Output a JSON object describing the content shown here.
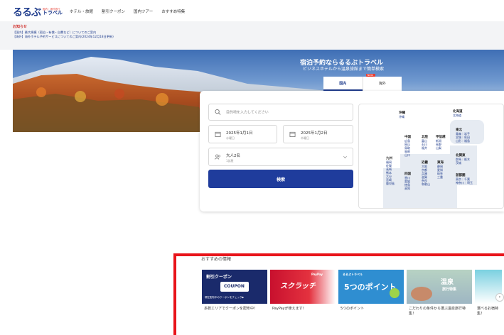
{
  "header": {
    "logo_mark": "るるぶ",
    "logo_tag": "国内・海外旅行",
    "logo_name": "トラベル",
    "nav": [
      "ホテル・旅館",
      "割引クーポン",
      "国内ツアー",
      "おすすめ特集"
    ]
  },
  "notice": {
    "title": "お知らせ",
    "links": [
      "【国内】最大規模（宿泊・有償・自費など）についてのご案内",
      "【海外】海外ホテル予約サービスについてのご案内(2024年12月18日更新)"
    ]
  },
  "hero": {
    "title": "宿泊予約ならるるぶトラベル",
    "subtitle": "ビジネスホテルから温泉旅館まで簡単検索",
    "tabs": [
      {
        "label": "国内",
        "active": true
      },
      {
        "label": "海外",
        "badge": "New!"
      }
    ]
  },
  "search": {
    "destination_placeholder": "目的地を入力してください",
    "checkin_date": "2025年1月1日",
    "checkin_day": "水曜日",
    "checkout_date": "2025年1月2日",
    "checkout_day": "木曜日",
    "guests": "大人2名",
    "rooms": "1部屋",
    "search_label": "検索"
  },
  "map": {
    "regions": [
      {
        "name": "沖縄",
        "prefs": [
          "沖縄"
        ]
      },
      {
        "name": "北海道",
        "prefs": [
          "北海道"
        ]
      },
      {
        "name": "東北",
        "prefs": [
          "青森｜岩手",
          "宮城｜秋田",
          "山形｜福島"
        ]
      },
      {
        "name": "中国",
        "prefs": [
          "広島",
          "岡山",
          "鳥取",
          "島根",
          "山口"
        ]
      },
      {
        "name": "北陸",
        "prefs": [
          "富山",
          "石川",
          "福井"
        ]
      },
      {
        "name": "甲信越",
        "prefs": [
          "新潟",
          "長野",
          "山梨"
        ]
      },
      {
        "name": "北関東",
        "prefs": [
          "群馬｜栃木",
          "茨城"
        ]
      },
      {
        "name": "九州",
        "prefs": [
          "福岡",
          "佐賀",
          "長崎",
          "熊本",
          "大分",
          "宮崎",
          "鹿児島"
        ]
      },
      {
        "name": "近畿",
        "prefs": [
          "大阪",
          "京都",
          "兵庫",
          "滋賀",
          "奈良",
          "和歌山"
        ]
      },
      {
        "name": "東海",
        "prefs": [
          "静岡",
          "愛知",
          "岐阜",
          "三重"
        ]
      },
      {
        "name": "首都圏",
        "prefs": [
          "東京｜千葉",
          "神奈川｜埼玉"
        ]
      },
      {
        "name": "四国",
        "prefs": [
          "香川",
          "愛媛",
          "徳島",
          "高知"
        ]
      }
    ]
  },
  "recommended": {
    "title": "おすすめの情報",
    "arrow": "›",
    "cards": [
      {
        "text": "多数エリアでクーポンを配布中！",
        "img_title": "割引クーポン",
        "img_sub": "COUPON",
        "img_note": "現在配布中のクーポンをチェック▶",
        "colors": [
          "#1a2a6b",
          "#e8473c"
        ]
      },
      {
        "text": "PayPayが使えます！",
        "img_title": "スクラッチ",
        "img_sub": "PayPay",
        "colors": [
          "#c8102e",
          "#1a1a1a"
        ]
      },
      {
        "text": "5つのポイント",
        "img_title": "5つのポイント",
        "img_sub": "るるぶトラベル",
        "colors": [
          "#2f8ed1",
          "#9ed34a"
        ]
      },
      {
        "text": "こだわりの条件から選ぶ温泉旅行特集！",
        "img_title": "温泉",
        "img_sub": "旅行特集",
        "colors": [
          "#b7d2c3",
          "#8fa8b8"
        ]
      },
      {
        "text": "選べるお宿特集！",
        "colors": [
          "#7ad0e0",
          "#ffffff"
        ]
      }
    ]
  }
}
